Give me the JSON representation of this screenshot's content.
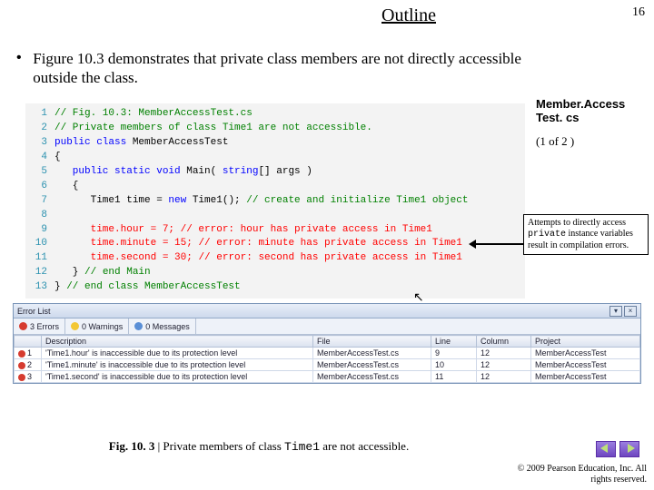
{
  "pageNumber": "16",
  "outline": "Outline",
  "bullet": "Figure 10.3 demonstrates that private class members are not directly accessible outside the class.",
  "fileLabelA": "Member.Access",
  "fileLabelB": "Test. cs",
  "partLabel": "(1 of 2 )",
  "code": {
    "l1": "// Fig. 10.3: MemberAccessTest.cs",
    "l2": "// Private members of class Time1 are not accessible.",
    "l3a": "public class",
    "l3b": " MemberAccessTest",
    "l4": "{",
    "l5a": "   public static void",
    "l5b": " Main( ",
    "l5c": "string",
    "l5d": "[] args )",
    "l6": "   {",
    "l7a": "      Time1 time = ",
    "l7b": "new",
    "l7c": " Time1(); ",
    "l7d": "// create and initialize Time1 object",
    "l8": "",
    "l9a": "      time.hour = 7; ",
    "l9b": "// error: hour has private access in Time1",
    "l10a": "      time.minute = 15; ",
    "l10b": "// error: minute has private access in Time1",
    "l11a": "      time.second = 30; ",
    "l11b": "// error: second has private access in Time1",
    "l12a": "   } ",
    "l12b": "// end Main",
    "l13a": "} ",
    "l13b": "// end class MemberAccessTest"
  },
  "callout": {
    "t1": "Attempts to directly access ",
    "mono": "private",
    "t2": " instance variables result in compilation errors."
  },
  "errorList": {
    "title": "Error List",
    "tabs": {
      "errors": "3 Errors",
      "warnings": "0 Warnings",
      "messages": "0 Messages"
    },
    "headers": {
      "blank": " ",
      "desc": "Description",
      "file": "File",
      "line": "Line",
      "col": "Column",
      "proj": "Project"
    },
    "rows": [
      {
        "n": "1",
        "desc": "'Time1.hour' is inaccessible due to its protection level",
        "file": "MemberAccessTest.cs",
        "line": "9",
        "col": "12",
        "proj": "MemberAccessTest"
      },
      {
        "n": "2",
        "desc": "'Time1.minute' is inaccessible due to its protection level",
        "file": "MemberAccessTest.cs",
        "line": "10",
        "col": "12",
        "proj": "MemberAccessTest"
      },
      {
        "n": "3",
        "desc": "'Time1.second' is inaccessible due to its protection level",
        "file": "MemberAccessTest.cs",
        "line": "11",
        "col": "12",
        "proj": "MemberAccessTest"
      }
    ]
  },
  "caption": {
    "fig": "Fig. 10. 3 ",
    "mid": "| Private members of class ",
    "mono": "Time1",
    "end": " are not accessible."
  },
  "copyright": "© 2009 Pearson Education, Inc.  All rights reserved."
}
